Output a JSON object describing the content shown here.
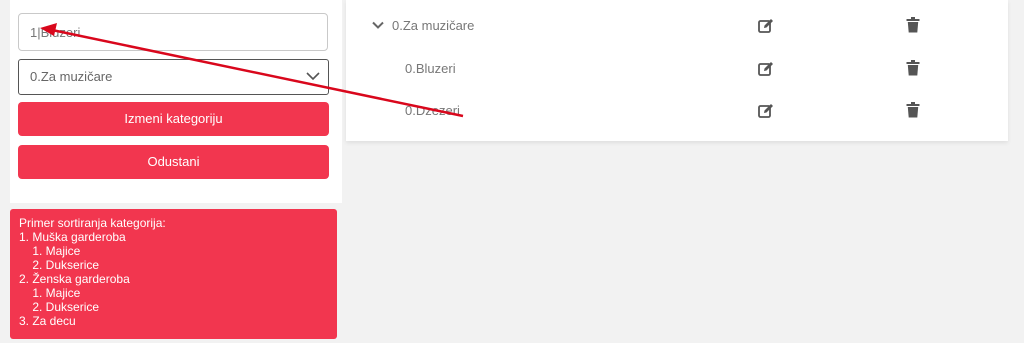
{
  "form": {
    "name_value": "1|Bluzeri",
    "parent_selected": "0.Za muzičare",
    "update_label": "Izmeni kategoriju",
    "cancel_label": "Odustani"
  },
  "hint": {
    "lines": [
      "Primer sortiranja kategorija:",
      "1. Muška garderoba",
      "    1. Majice",
      "    2. Dukserice",
      "2. Ženska garderoba",
      "    1. Majice",
      "    2. Dukserice",
      "3. Za decu"
    ]
  },
  "tree": {
    "rows": [
      {
        "label": "0.Za muzičare",
        "expanded": true
      },
      {
        "label": "0.Bluzeri"
      },
      {
        "label": "0.Dzezeri"
      }
    ]
  },
  "colors": {
    "accent": "#f2364f",
    "annotation_arrow": "#d9071c"
  },
  "icons": {
    "edit": "edit-icon",
    "delete": "trash-icon",
    "expand": "chevron-down-icon"
  }
}
